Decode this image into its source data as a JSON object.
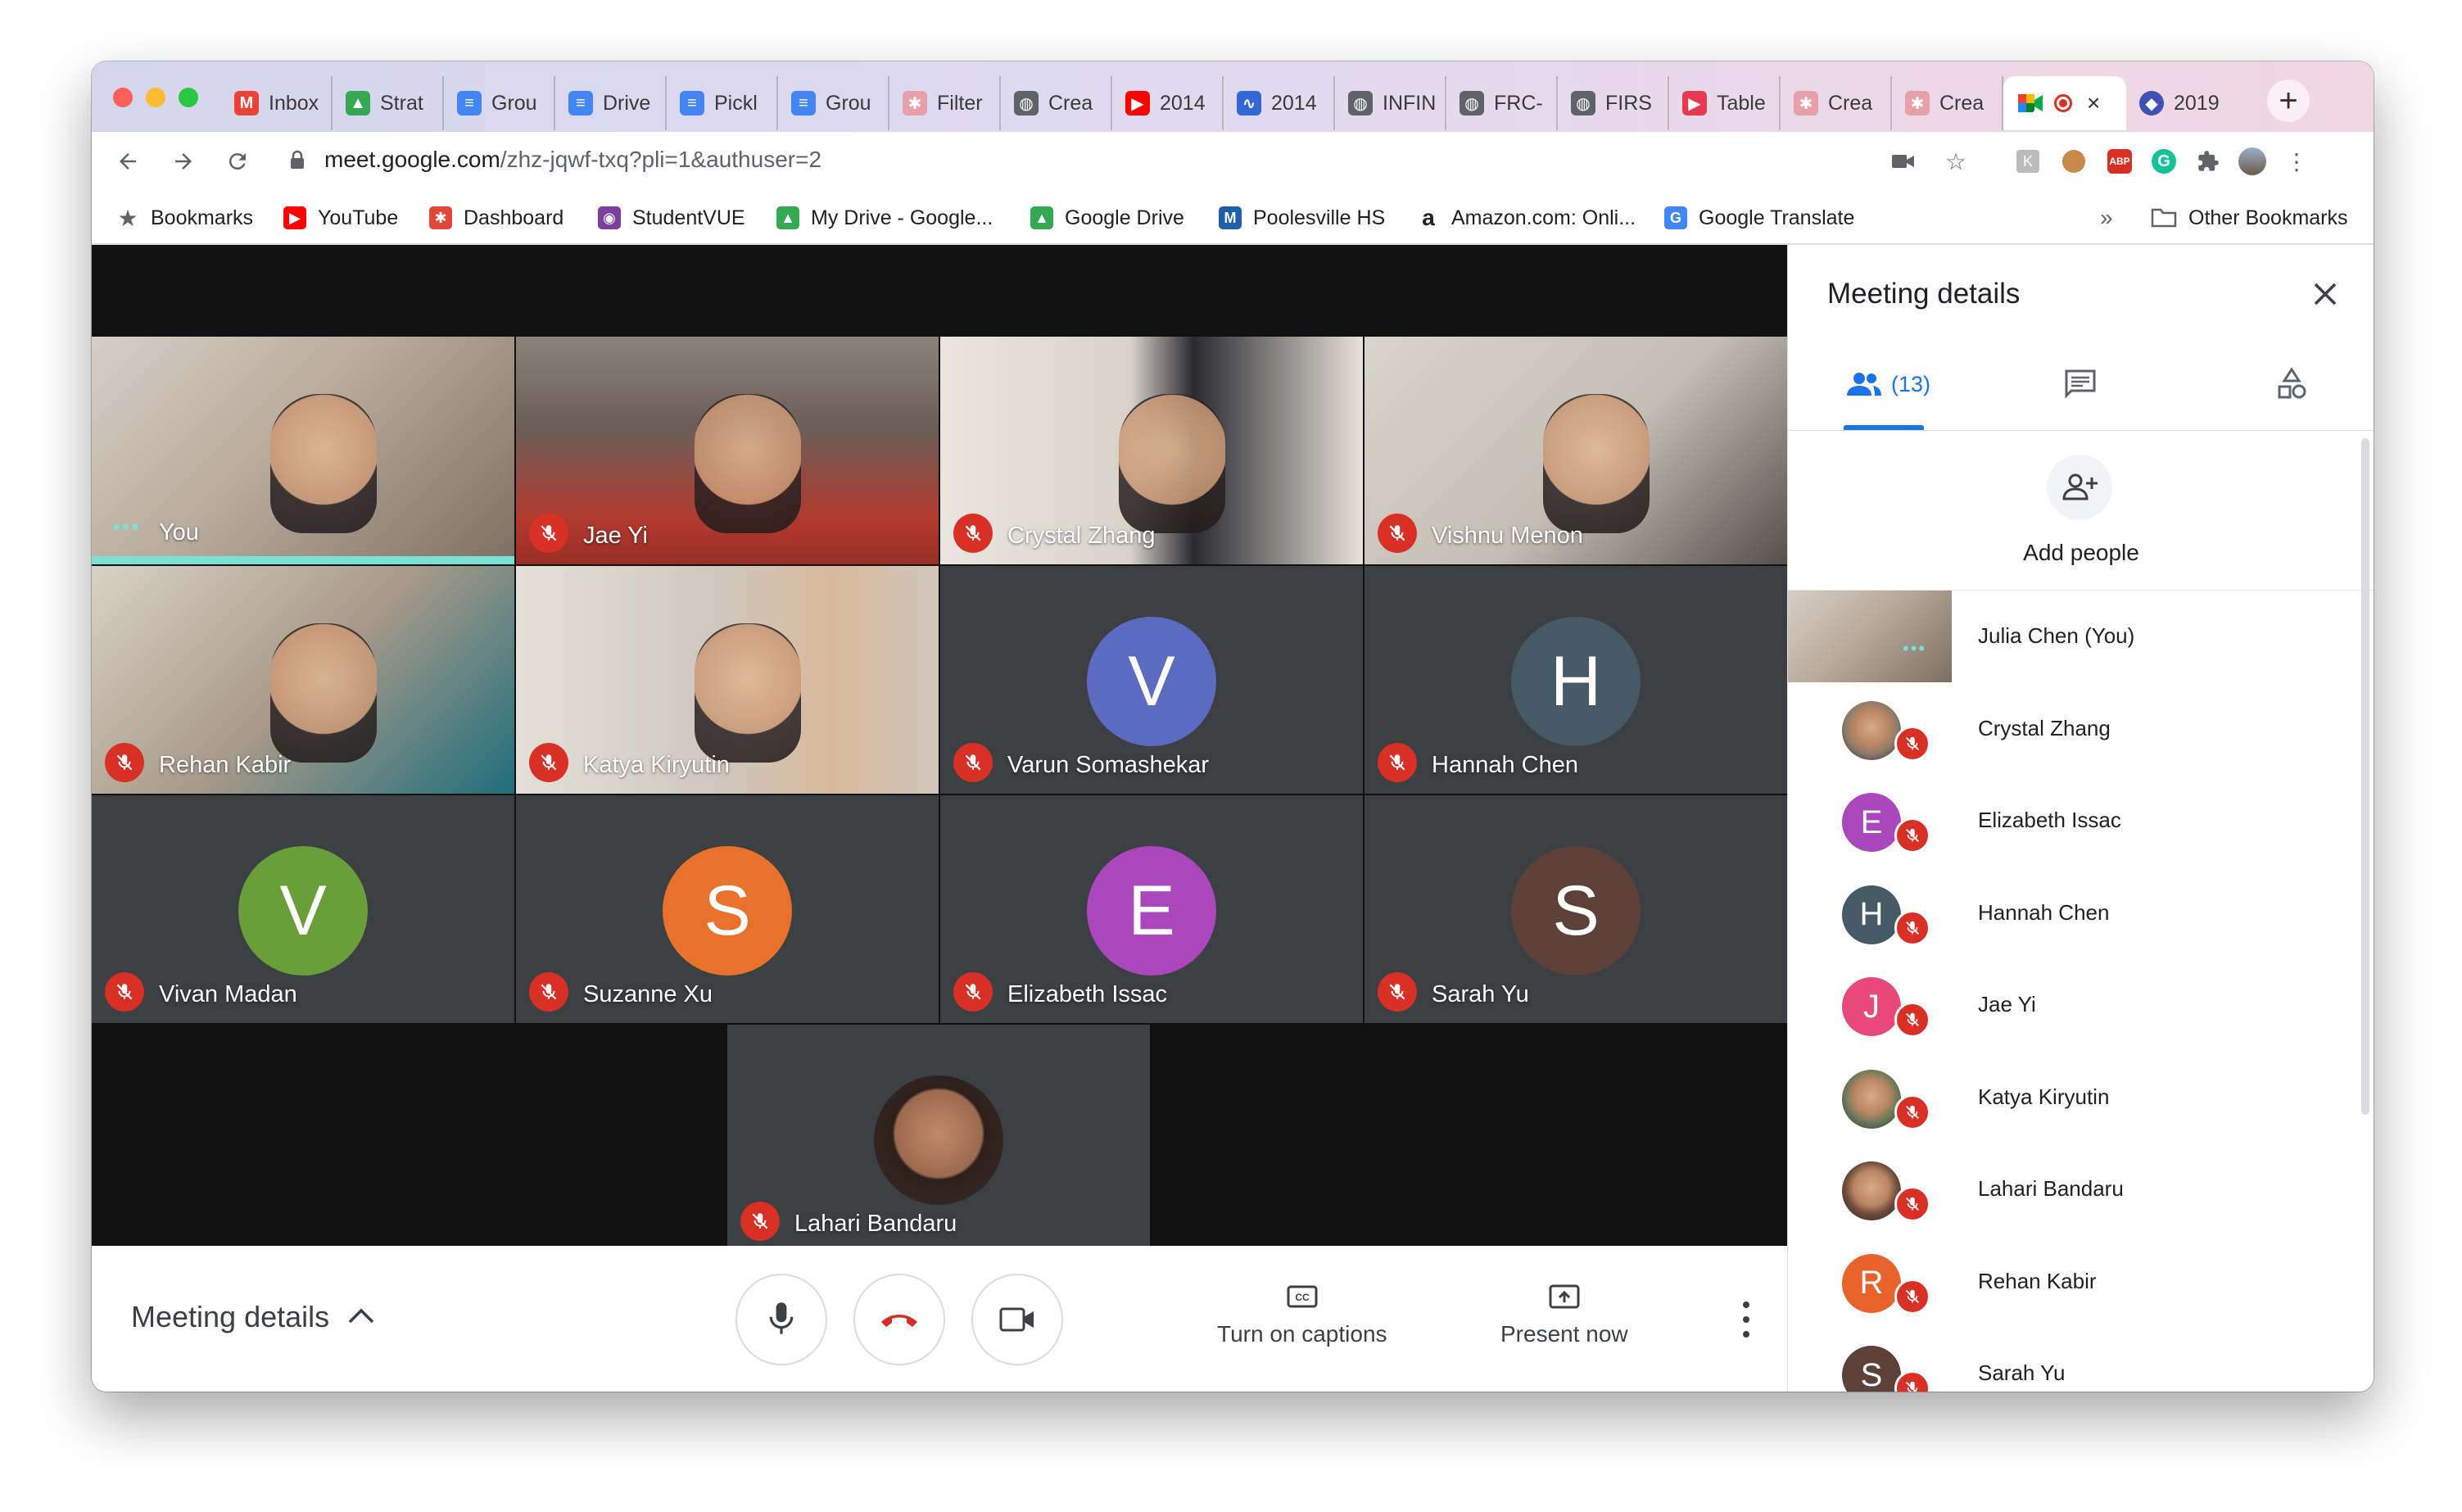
{
  "browser": {
    "tabs": [
      {
        "label": "Inbox",
        "icon": "gmail-icon",
        "color": "#ea4335",
        "glyph": "M"
      },
      {
        "label": "Strat",
        "icon": "google-drive-icon",
        "color": "#34a853",
        "glyph": "▲"
      },
      {
        "label": "Grou",
        "icon": "google-docs-icon",
        "color": "#4285f4",
        "glyph": "≡"
      },
      {
        "label": "Drive",
        "icon": "google-docs-icon",
        "color": "#4285f4",
        "glyph": "≡"
      },
      {
        "label": "Pickl",
        "icon": "google-docs-icon",
        "color": "#4285f4",
        "glyph": "≡"
      },
      {
        "label": "Grou",
        "icon": "google-docs-icon",
        "color": "#4285f4",
        "glyph": "≡"
      },
      {
        "label": "Filter",
        "icon": "sunburst-icon",
        "color": "#e8a0a8",
        "glyph": "✱"
      },
      {
        "label": "Crea",
        "icon": "globe-icon",
        "color": "#5f6368",
        "glyph": "◍"
      },
      {
        "label": "2014",
        "icon": "youtube-icon",
        "color": "#ff0000",
        "glyph": "▶"
      },
      {
        "label": "2014",
        "icon": "chart-logo-icon",
        "color": "#3367d6",
        "glyph": "∿"
      },
      {
        "label": "INFIN",
        "icon": "globe-icon",
        "color": "#5f6368",
        "glyph": "◍"
      },
      {
        "label": "FRC-",
        "icon": "globe-icon",
        "color": "#5f6368",
        "glyph": "◍"
      },
      {
        "label": "FIRS",
        "icon": "globe-icon",
        "color": "#5f6368",
        "glyph": "◍"
      },
      {
        "label": "Table",
        "icon": "play-circle-icon",
        "color": "#e53950",
        "glyph": "▶"
      },
      {
        "label": "Crea",
        "icon": "sunburst-icon",
        "color": "#e8a0a8",
        "glyph": "✱"
      },
      {
        "label": "Crea",
        "icon": "sunburst-icon",
        "color": "#e8a0a8",
        "glyph": "✱"
      }
    ],
    "active_tab": {
      "icon": "google-meet-icon",
      "recording": true,
      "close": "×"
    },
    "after_tab": {
      "label": "2019",
      "icon": "shield-icon",
      "color": "#3f51b5",
      "glyph": "◆"
    },
    "new_tab": "+",
    "url_host": "meet.google.com",
    "url_path": "/zhz-jqwf-txq?pli=1&authuser=2",
    "bookmarks": [
      {
        "label": "Bookmarks",
        "icon": "star-icon",
        "color": "#5f6368",
        "glyph": "★"
      },
      {
        "label": "YouTube",
        "icon": "youtube-icon",
        "color": "#ff0000",
        "glyph": "▶"
      },
      {
        "label": "Dashboard",
        "icon": "dashboard-icon",
        "color": "#e0463a",
        "glyph": "✱"
      },
      {
        "label": "StudentVUE",
        "icon": "studentvue-icon",
        "color": "#7b3fa0",
        "glyph": "◉"
      },
      {
        "label": "My Drive - Google...",
        "icon": "google-drive-icon",
        "color": "#34a853",
        "glyph": "▲"
      },
      {
        "label": "Google Drive",
        "icon": "google-drive-icon",
        "color": "#34a853",
        "glyph": "▲"
      },
      {
        "label": "Poolesville HS",
        "icon": "mcps-icon",
        "color": "#1f5fa8",
        "glyph": "M"
      },
      {
        "label": "Amazon.com: Onli...",
        "icon": "amazon-icon",
        "color": "#222222",
        "glyph": "a"
      },
      {
        "label": "Google Translate",
        "icon": "translate-icon",
        "color": "#4285f4",
        "glyph": "G"
      }
    ],
    "bookmarks_overflow": "»",
    "other_bookmarks": "Other Bookmarks"
  },
  "meet": {
    "tiles": [
      {
        "name": "You",
        "kind": "video",
        "speaking": true,
        "indicator": "•••"
      },
      {
        "name": "Jae Yi",
        "kind": "video",
        "muted": true
      },
      {
        "name": "Crystal Zhang",
        "kind": "video",
        "muted": true
      },
      {
        "name": "Vishnu Menon",
        "kind": "video",
        "muted": true
      },
      {
        "name": "Rehan Kabir",
        "kind": "video",
        "muted": true
      },
      {
        "name": "Katya Kiryutin",
        "kind": "video",
        "muted": true
      },
      {
        "name": "Varun Somashekar",
        "kind": "avatar",
        "initial": "V",
        "color": "#5c6bc0",
        "muted": true
      },
      {
        "name": "Hannah Chen",
        "kind": "avatar",
        "initial": "H",
        "color": "#455a64",
        "muted": true
      },
      {
        "name": "Vivan Madan",
        "kind": "avatar",
        "initial": "V",
        "color": "#689f38",
        "muted": true
      },
      {
        "name": "Suzanne Xu",
        "kind": "avatar",
        "initial": "S",
        "color": "#e8712b",
        "muted": true
      },
      {
        "name": "Elizabeth Issac",
        "kind": "avatar",
        "initial": "E",
        "color": "#ab47bc",
        "muted": true
      },
      {
        "name": "Sarah Yu",
        "kind": "avatar",
        "initial": "S",
        "color": "#5d4037",
        "muted": true
      },
      {
        "name": "Lahari Bandaru",
        "kind": "photo-avatar",
        "muted": true
      }
    ],
    "bottom": {
      "meeting_details": "Meeting details",
      "captions": "Turn on captions",
      "present": "Present now"
    },
    "panel": {
      "title": "Meeting details",
      "people_count": "(13)",
      "add_people": "Add people",
      "people": [
        {
          "name": "Julia Chen (You)",
          "kind": "self"
        },
        {
          "name": "Crystal Zhang",
          "kind": "photo",
          "color": "#8d7b6a"
        },
        {
          "name": "Elizabeth Issac",
          "kind": "initial",
          "initial": "E",
          "color": "#ab47bc"
        },
        {
          "name": "Hannah Chen",
          "kind": "initial",
          "initial": "H",
          "color": "#455a64"
        },
        {
          "name": "Jae Yi",
          "kind": "initial",
          "initial": "J",
          "color": "#e8497a"
        },
        {
          "name": "Katya Kiryutin",
          "kind": "photo",
          "color": "#6b7a5a"
        },
        {
          "name": "Lahari Bandaru",
          "kind": "photo",
          "color": "#6d4a3a"
        },
        {
          "name": "Rehan Kabir",
          "kind": "initial",
          "initial": "R",
          "color": "#e8622b"
        },
        {
          "name": "Sarah Yu",
          "kind": "initial",
          "initial": "S",
          "color": "#5d4037"
        }
      ]
    }
  }
}
